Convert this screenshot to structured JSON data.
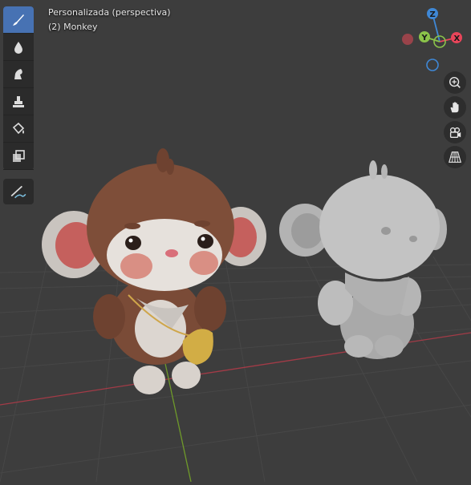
{
  "viewport": {
    "view_name": "Personalizada (perspectiva)",
    "active_object": "(2) Monkey"
  },
  "toolbar": {
    "tools": [
      {
        "name": "brush-tool",
        "icon": "paintbrush-icon",
        "active": true
      },
      {
        "name": "soften-tool",
        "icon": "drop-icon",
        "active": false
      },
      {
        "name": "smear-tool",
        "icon": "smear-icon",
        "active": false
      },
      {
        "name": "clone-tool",
        "icon": "stamp-icon",
        "active": false
      },
      {
        "name": "fill-tool",
        "icon": "bucket-icon",
        "active": false
      },
      {
        "name": "mask-tool",
        "icon": "mask-icon",
        "active": false
      },
      {
        "name": "annotate-tool",
        "icon": "annotate-icon",
        "active": false
      }
    ]
  },
  "gizmo": {
    "axes": {
      "x": "X",
      "y": "Y",
      "z": "Z"
    },
    "colors": {
      "x": "#e8455a",
      "y": "#8bc34a",
      "z": "#3f88d6"
    }
  },
  "nav_buttons": [
    "zoom-icon",
    "hand-icon",
    "camera-icon",
    "grid-view-icon"
  ],
  "colors": {
    "background": "#3d3d3d",
    "grid_line": "#484848",
    "x_axis": "#a83a45",
    "y_axis": "#6f9a2a",
    "active_tool": "#4772b3"
  }
}
